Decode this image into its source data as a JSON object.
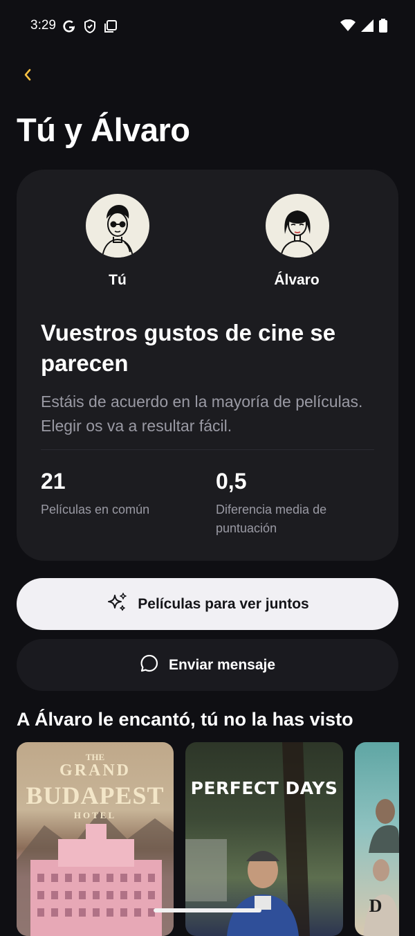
{
  "status_bar": {
    "time": "3:29"
  },
  "header": {
    "title": "Tú y Álvaro"
  },
  "match": {
    "user_a": {
      "name": "Tú"
    },
    "user_b": {
      "name": "Álvaro"
    },
    "heading": "Vuestros gustos de cine se parecen",
    "description": "Estáis de acuerdo en la mayoría de películas. Elegir os va a resultar fácil.",
    "stats": [
      {
        "value": "21",
        "label": "Películas en común"
      },
      {
        "value": "0,5",
        "label": "Diferencia media de puntuación"
      }
    ]
  },
  "actions": {
    "watch_together": "Películas para ver juntos",
    "send_message": "Enviar mensaje"
  },
  "section": {
    "title": "A Álvaro le encantó, tú no la has visto",
    "posters": [
      {
        "title_small": "THE",
        "title_top": "GRAND",
        "title_main": "BUDAPEST",
        "title_bottom": "HOTEL"
      },
      {
        "title_main": "PERFECT DAYS"
      },
      {
        "title_main": "D"
      }
    ]
  },
  "colors": {
    "accent": "#f5c043",
    "background": "#0f0f13",
    "card": "#1c1c20",
    "primary_button": "#f1f0f4"
  }
}
